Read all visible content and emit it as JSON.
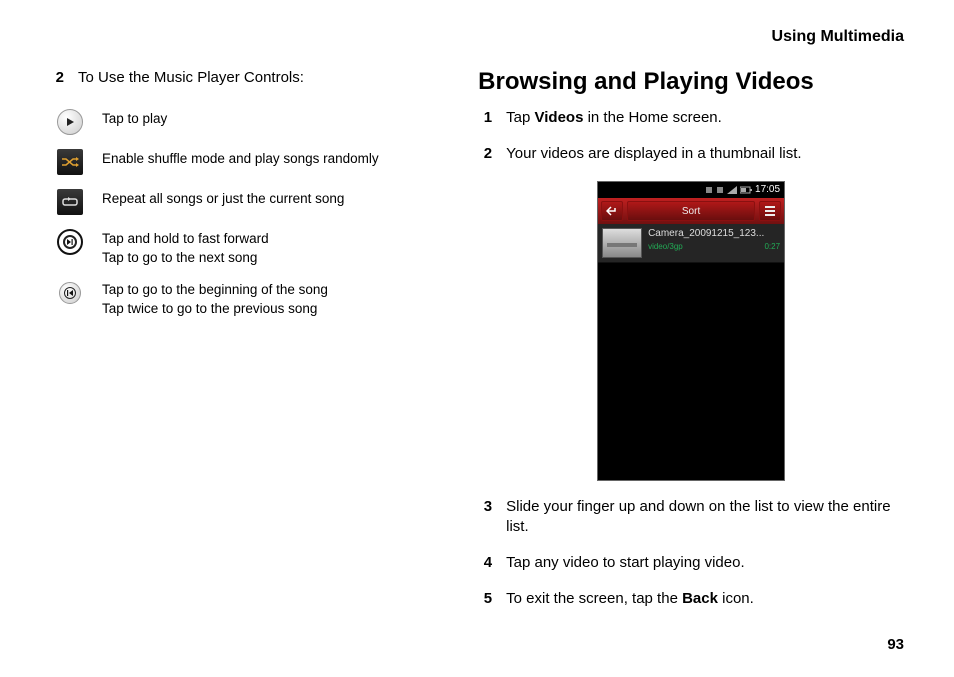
{
  "header": {
    "section": "Using Multimedia"
  },
  "page_number": "93",
  "left": {
    "step_num": "2",
    "step_text": "To Use the Music Player Controls:",
    "controls": [
      {
        "line1": "Tap to play",
        "line2": ""
      },
      {
        "line1": "Enable shuffle mode and play songs randomly",
        "line2": ""
      },
      {
        "line1": "Repeat all songs or just the current song",
        "line2": ""
      },
      {
        "line1": "Tap and hold to fast forward",
        "line2": "Tap to go to the next song"
      },
      {
        "line1": "Tap to go to the beginning of the song",
        "line2": "Tap twice to go to the previous song"
      }
    ]
  },
  "right": {
    "heading": "Browsing and Playing Videos",
    "steps": {
      "s1": {
        "num": "1",
        "pre": "Tap ",
        "bold": "Videos",
        "post": " in the Home screen."
      },
      "s2": {
        "num": "2",
        "text": "Your videos are displayed in a thumbnail list."
      },
      "s3": {
        "num": "3",
        "text": "Slide your finger up and down on the list to view the entire list."
      },
      "s4": {
        "num": "4",
        "text": "Tap any video to start playing video."
      },
      "s5": {
        "num": "5",
        "pre": "To exit the screen, tap the ",
        "bold": "Back",
        "post": " icon."
      }
    },
    "phone": {
      "time": "17:05",
      "sort": "Sort",
      "video_name": "Camera_20091215_123...",
      "video_type": "video/3gp",
      "video_dur": "0:27"
    }
  }
}
